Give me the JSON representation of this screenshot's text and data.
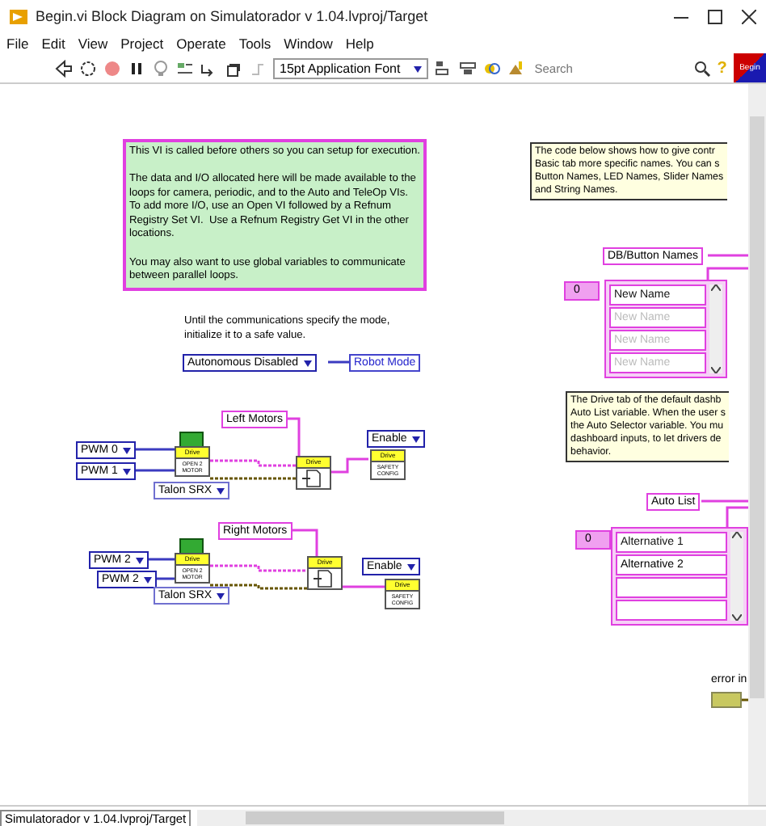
{
  "window": {
    "title": "Begin.vi Block Diagram on Simulatorador v 1.04.lvproj/Target"
  },
  "menu": [
    "File",
    "Edit",
    "View",
    "Project",
    "Operate",
    "Tools",
    "Window",
    "Help"
  ],
  "toolbar": {
    "font_menu": "15pt Application Font",
    "search": {
      "placeholder": "Search"
    },
    "help": "?",
    "vi_icon_text": "Begin"
  },
  "diagram": {
    "comments": [
      {
        "kind": "note",
        "text": "This VI is called before others so you can setup for execution.\n\nThe data and I/O allocated here will be made available to the\nloops for camera, periodic, and to the Auto and TeleOp VIs.\nTo add more I/O, use an Open VI followed by a Refnum\nRegistry Set VI.  Use a Refnum Registry Get VI in the other\nlocations.\n\nYou may also want to use global variables to communicate\nbetween parallel loops."
      },
      {
        "kind": "free",
        "text": "Until the communications specify the mode,\ninitialize it to a safe value."
      },
      {
        "kind": "tip",
        "text": "The code below shows how to give contr\nBasic tab more specific names. You can s\nButton Names, LED Names, Slider Names\nand String Names."
      },
      {
        "kind": "tip",
        "text": "The Drive tab of the default dashb\nAuto List variable. When the user s\nthe Auto Selector variable. You mu\ndashboard inputs, to let drivers de\nbehavior."
      }
    ],
    "mode": {
      "value": "Autonomous Disabled",
      "global": "Robot Mode"
    },
    "motor_groups": [
      {
        "name": "Left Motors",
        "channels": [
          "PWM 0",
          "PWM 1"
        ],
        "controller": "Talon SRX",
        "open_vi": {
          "header": "Drive",
          "body": "OPEN 2 MOTOR"
        },
        "set_vi": {
          "header": "Drive"
        },
        "enable": "Enable",
        "safety_vi": {
          "header": "Drive",
          "body": "SAFETY CONFIG"
        }
      },
      {
        "name": "Right Motors",
        "channels": [
          "PWM 2",
          "PWM 2"
        ],
        "controller": "Talon SRX",
        "open_vi": {
          "header": "Drive",
          "body": "OPEN 2 MOTOR"
        },
        "set_vi": {
          "header": "Drive"
        },
        "enable": "Enable",
        "safety_vi": {
          "header": "Drive",
          "body": "SAFETY CONFIG"
        }
      }
    ],
    "arrays": [
      {
        "name": "DB/Button Names",
        "index": "0",
        "items": [
          {
            "text": "New Name",
            "greyed": false
          },
          {
            "text": "New Name",
            "greyed": true
          },
          {
            "text": "New Name",
            "greyed": true
          },
          {
            "text": "New Name",
            "greyed": true
          }
        ]
      },
      {
        "name": "Auto List",
        "index": "0",
        "items": [
          {
            "text": "Alternative 1",
            "greyed": false
          },
          {
            "text": "Alternative 2",
            "greyed": false
          }
        ]
      }
    ],
    "error_in": {
      "label": "error in"
    }
  },
  "status_bar": {
    "path": "Simulatorador v 1.04.lvproj/Target"
  }
}
